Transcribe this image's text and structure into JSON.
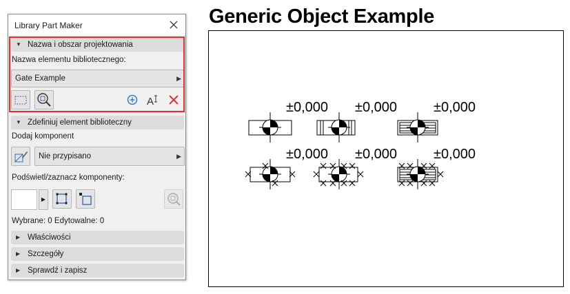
{
  "panel": {
    "title": "Library Part Maker",
    "section_name": "Nazwa i obszar projektowania",
    "name_label": "Nazwa elementu bibliotecznego:",
    "name_value": "Gate Example",
    "section_define": "Zdefiniuj element biblioteczny",
    "add_component_label": "Dodaj komponent",
    "component_value": "Nie przypisano",
    "highlight_label": "Podświetl/zaznacz komponenty:",
    "status": "Wybrane: 0 Edytowalne: 0",
    "section_properties": "Właściwości",
    "section_details": "Szczegóły",
    "section_check": "Sprawdź i zapisz"
  },
  "preview": {
    "title": "Generic Object Example",
    "elevations": [
      "±0,000",
      "±0,000",
      "±0,000",
      "±0,000",
      "±0,000",
      "±0,000"
    ]
  },
  "colors": {
    "highlight": "#e0302a",
    "accent_blue": "#1e6fd0",
    "delete_red": "#e0302a"
  }
}
